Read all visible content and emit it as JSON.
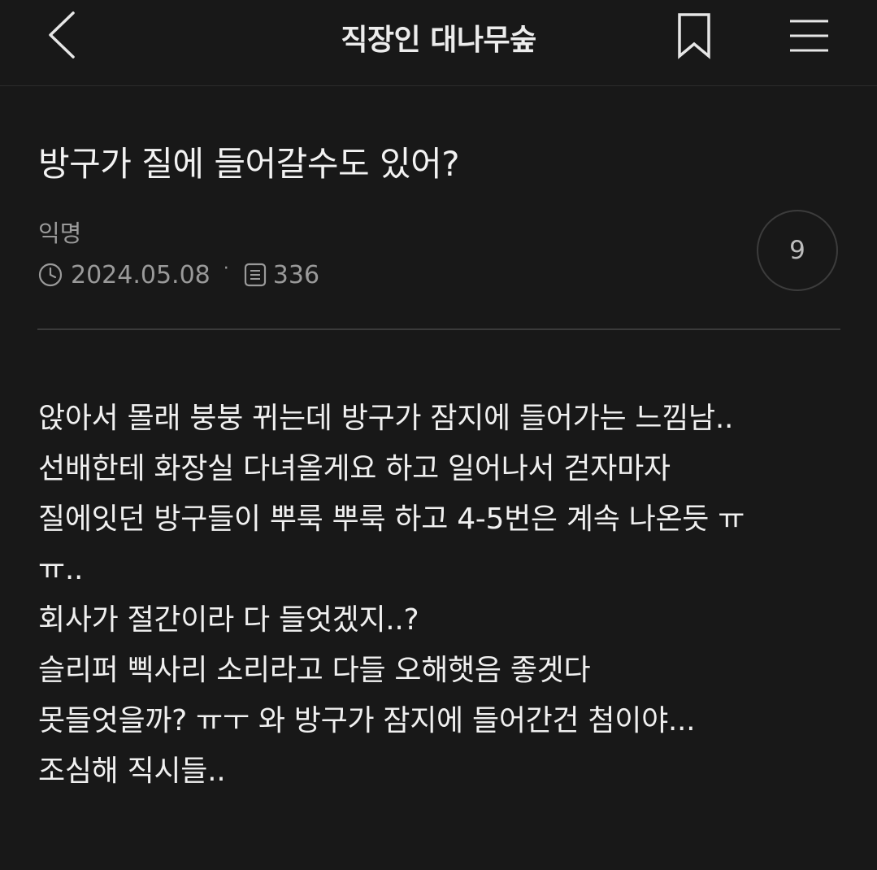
{
  "header": {
    "title": "직장인 대나무숲",
    "back_icon": "chevron-left-icon",
    "bookmark_icon": "bookmark-icon",
    "menu_icon": "hamburger-menu-icon"
  },
  "post": {
    "title": "방구가 질에 들어갈수도 있어?",
    "author": "익명",
    "date": "2024.05.08",
    "separator": "·",
    "views": "336",
    "comment_count": "9",
    "body_lines": [
      "앉아서 몰래 붕붕 뀌는데 방구가 잠지에 들어가는 느낌남..",
      "선배한테 화장실 다녀올게요 하고 일어나서 걷자마자",
      "질에잇던 방구들이 뿌룩 뿌룩 하고 4-5번은 계속 나온듯 ㅠ",
      "ㅠ..",
      "회사가 절간이라 다 들엇겠지..?",
      "슬리퍼 삑사리 소리라고 다들 오해햇음 좋겟다",
      "못들엇을까? ㅠㅜ 와 방구가 잠지에 들어간건 첨이야...",
      "조심해 직시들.."
    ]
  },
  "colors": {
    "background": "#181818",
    "text": "#f0f0f0",
    "muted": "#9a9a9a",
    "divider": "#3a3a3a"
  }
}
